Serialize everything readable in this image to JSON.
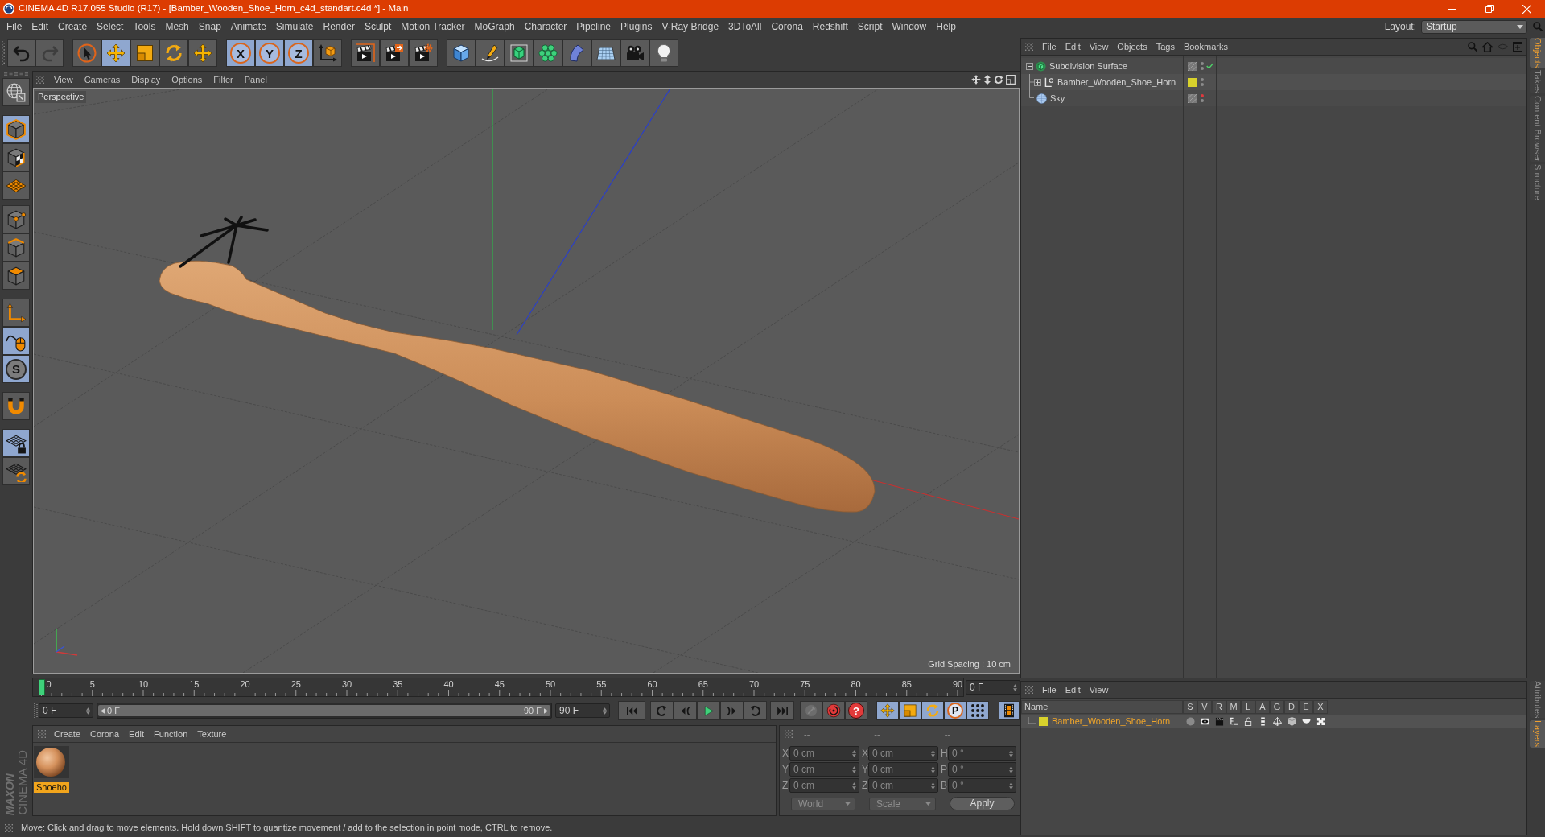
{
  "window": {
    "title": "CINEMA 4D R17.055 Studio (R17) - [Bamber_Wooden_Shoe_Horn_c4d_standart.c4d *] - Main"
  },
  "menu_bar": {
    "items": [
      "File",
      "Edit",
      "Create",
      "Select",
      "Tools",
      "Mesh",
      "Snap",
      "Animate",
      "Simulate",
      "Render",
      "Sculpt",
      "Motion Tracker",
      "MoGraph",
      "Character",
      "Pipeline",
      "Plugins",
      "V-Ray Bridge",
      "3DToAll",
      "Corona",
      "Redshift",
      "Script",
      "Window",
      "Help"
    ],
    "layout_label": "Layout:",
    "layout_value": "Startup"
  },
  "toolbar": {
    "history": [
      {
        "kind": "undo",
        "disabled": false
      },
      {
        "kind": "redo",
        "disabled": true
      }
    ],
    "groups": [
      [
        {
          "kind": "select",
          "active": false
        },
        {
          "kind": "move",
          "active": true
        },
        {
          "kind": "scale",
          "active": false
        },
        {
          "kind": "rotate",
          "active": false
        },
        {
          "kind": "transform",
          "active": false
        }
      ],
      [
        {
          "kind": "axis",
          "label": "X",
          "active": true
        },
        {
          "kind": "axis",
          "label": "Y",
          "active": true
        },
        {
          "kind": "axis",
          "label": "Z",
          "active": true
        },
        {
          "kind": "coordinates",
          "active": false
        }
      ],
      [
        {
          "kind": "render_view",
          "active": false
        },
        {
          "kind": "render_viewer",
          "active": false
        },
        {
          "kind": "render_settings",
          "active": false
        }
      ],
      [
        {
          "kind": "cube",
          "active": false
        },
        {
          "kind": "pen",
          "active": false
        },
        {
          "kind": "subdivision",
          "active": false
        },
        {
          "kind": "cloner",
          "active": false
        },
        {
          "kind": "bend",
          "active": false
        },
        {
          "kind": "floor",
          "active": false
        },
        {
          "kind": "camera",
          "active": false
        },
        {
          "kind": "light",
          "active": false
        }
      ]
    ]
  },
  "mode_toolbar": {
    "groups": [
      [
        {
          "kind": "make_editable",
          "active": false
        }
      ],
      [
        {
          "kind": "model",
          "active": true
        },
        {
          "kind": "texture",
          "active": false
        },
        {
          "kind": "workplane",
          "active": false
        }
      ],
      [
        {
          "kind": "points",
          "active": false
        },
        {
          "kind": "edges",
          "active": false
        },
        {
          "kind": "polygons",
          "active": false
        }
      ],
      [
        {
          "kind": "axis_mode",
          "active": false
        },
        {
          "kind": "tweak",
          "active": true
        },
        {
          "kind": "snap",
          "label": "S",
          "active": true
        }
      ],
      [
        {
          "kind": "magnet",
          "active": false
        }
      ],
      [
        {
          "kind": "lock_workplane",
          "active": true
        },
        {
          "kind": "align_workplane",
          "active": false
        }
      ]
    ]
  },
  "logo": {
    "brand": "MAXON",
    "product": "CINEMA 4D"
  },
  "viewport": {
    "menu": [
      "View",
      "Cameras",
      "Display",
      "Options",
      "Filter",
      "Panel"
    ],
    "camera": "Perspective",
    "grid_spacing": "Grid Spacing : 10 cm"
  },
  "timeline": {
    "ticks": [
      "0",
      "5",
      "10",
      "15",
      "20",
      "25",
      "30",
      "35",
      "40",
      "45",
      "50",
      "55",
      "60",
      "65",
      "70",
      "75",
      "80",
      "85",
      "90"
    ],
    "playhead": {
      "level": 0
    },
    "current_frame": "0 F"
  },
  "transport": {
    "start_frame": "0 F",
    "range": {
      "start": "0 F",
      "end": "90 F",
      "level": 1
    },
    "end_frame": "90 F",
    "playback": [
      {
        "kind": "to_start"
      },
      {
        "kind": "prev_key"
      },
      {
        "kind": "prev_frame"
      },
      {
        "kind": "play"
      },
      {
        "kind": "next_frame"
      },
      {
        "kind": "next_key"
      },
      {
        "kind": "to_end"
      }
    ],
    "keys": [
      {
        "kind": "record",
        "disabled": true
      },
      {
        "kind": "autokey",
        "disabled": false
      },
      {
        "kind": "keyframe_selection",
        "label": "?",
        "disabled": false
      }
    ],
    "key_tools": [
      {
        "kind": "move",
        "active": true
      },
      {
        "kind": "scale",
        "active": true
      },
      {
        "kind": "rotate",
        "active": true
      },
      {
        "kind": "parameter",
        "label": "P",
        "active": true
      },
      {
        "kind": "key_points",
        "active": true
      }
    ],
    "timeline_button": {
      "kind": "timeline",
      "active": true
    }
  },
  "material_manager": {
    "menu": [
      "Create",
      "Corona",
      "Edit",
      "Function",
      "Texture"
    ],
    "materials": [
      {
        "name": "Shoeho",
        "selected": true
      }
    ]
  },
  "coordinates": {
    "headers": [
      "--",
      "--",
      "--"
    ],
    "rows": [
      {
        "axis": "X",
        "position": "0 cm",
        "size_axis": "X",
        "size": "0 cm",
        "rotation_axis": "H",
        "rotation": "0 °"
      },
      {
        "axis": "Y",
        "position": "0 cm",
        "size_axis": "Y",
        "size": "0 cm",
        "rotation_axis": "P",
        "rotation": "0 °"
      },
      {
        "axis": "Z",
        "position": "0 cm",
        "size_axis": "Z",
        "size": "0 cm",
        "rotation_axis": "B",
        "rotation": "0 °"
      }
    ],
    "space": "World",
    "mode": "Scale",
    "apply": "Apply"
  },
  "status_bar": {
    "text": "Move: Click and drag to move elements. Hold down SHIFT to quantize movement / add to the selection in point mode, CTRL to remove."
  },
  "object_manager": {
    "menu": [
      "File",
      "Edit",
      "View",
      "Objects",
      "Tags",
      "Bookmarks"
    ],
    "objects": [
      {
        "name": "Subdivision Surface",
        "kind": "subdivision",
        "expanded": true,
        "hidden_in_editor": false,
        "hidden_in_render": false,
        "enabled": true,
        "children": [
          {
            "name": "Bamber_Wooden_Shoe_Horn",
            "kind": "null",
            "expanded": false,
            "color": "#d8d22c",
            "hidden_in_editor": false,
            "hidden_in_render": false,
            "enabled": false
          }
        ]
      },
      {
        "name": "Sky",
        "kind": "sky",
        "hidden_in_editor": true,
        "hidden_in_render": false,
        "enabled": false
      }
    ]
  },
  "layer_manager": {
    "menu": [
      "File",
      "Edit",
      "View"
    ],
    "columns": [
      "Name",
      "S",
      "V",
      "R",
      "M",
      "L",
      "A",
      "G",
      "D",
      "E",
      "X"
    ],
    "layers": [
      {
        "name": "Bamber_Wooden_Shoe_Horn",
        "color": "#d8d22c"
      }
    ]
  },
  "side_tabs": {
    "top": [
      {
        "label": "Objects",
        "selected": true
      },
      {
        "label": "Takes",
        "selected": false
      },
      {
        "label": "Content Browser",
        "selected": false
      },
      {
        "label": "Structure",
        "selected": false
      }
    ],
    "bottom": [
      {
        "label": "Attributes",
        "selected": false
      },
      {
        "label": "Layers",
        "selected": true
      }
    ]
  }
}
